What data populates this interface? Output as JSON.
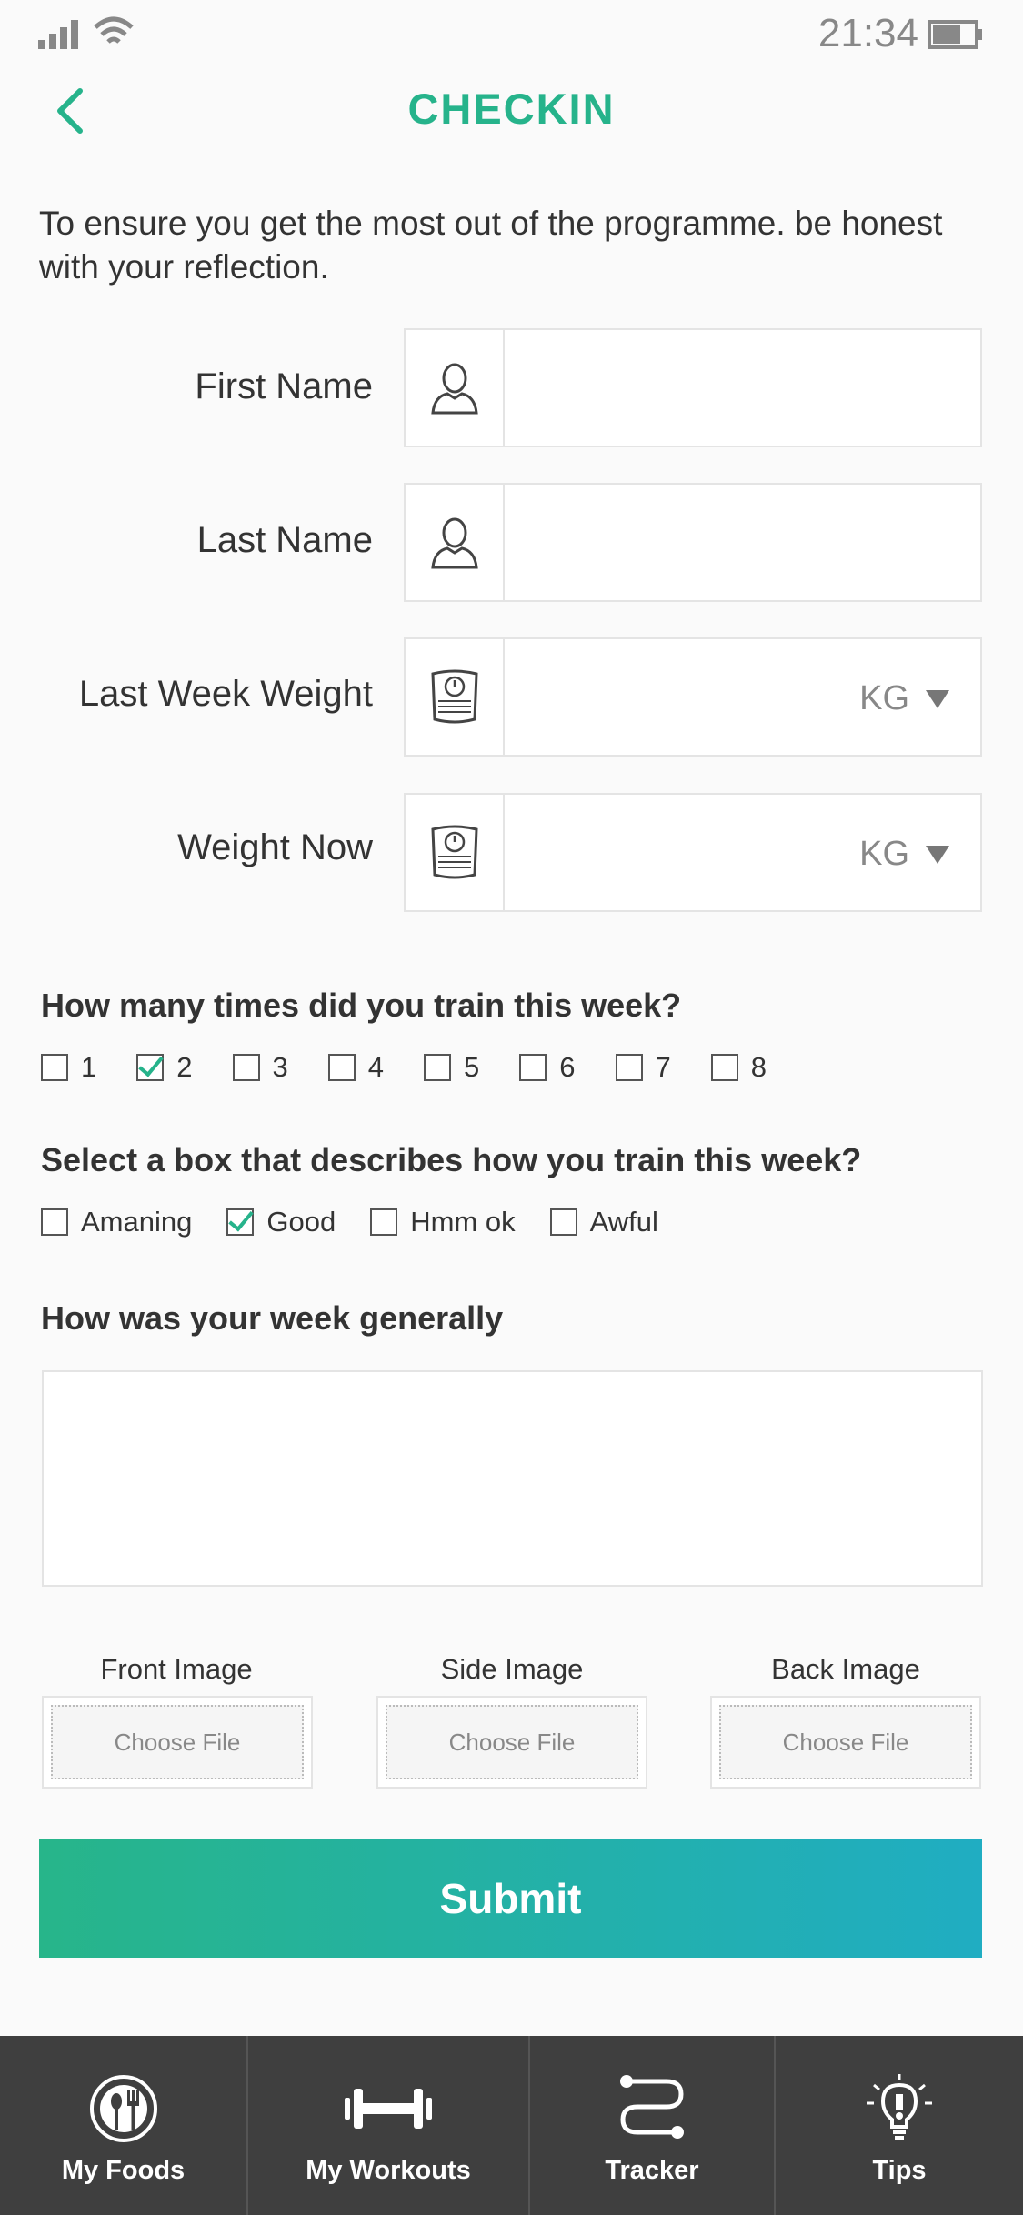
{
  "status": {
    "time": "21:34"
  },
  "header": {
    "title": "CHECKIN"
  },
  "intro": "To ensure you get the most out of the programme. be honest with your reflection.",
  "form": {
    "first_name": {
      "label": "First Name",
      "value": ""
    },
    "last_name": {
      "label": "Last Name",
      "value": ""
    },
    "last_week_weight": {
      "label": "Last Week Weight",
      "value": "",
      "unit": "KG"
    },
    "weight_now": {
      "label": "Weight Now",
      "value": "",
      "unit": "KG"
    }
  },
  "training": {
    "question": "How many times did you train this week?",
    "options": [
      {
        "label": "1",
        "checked": false
      },
      {
        "label": "2",
        "checked": true
      },
      {
        "label": "3",
        "checked": false
      },
      {
        "label": "4",
        "checked": false
      },
      {
        "label": "5",
        "checked": false
      },
      {
        "label": "6",
        "checked": false
      },
      {
        "label": "7",
        "checked": false
      },
      {
        "label": "8",
        "checked": false
      }
    ]
  },
  "quality": {
    "question": "Select a box that describes how you train this week?",
    "options": [
      {
        "label": "Amaning",
        "checked": false
      },
      {
        "label": "Good",
        "checked": true
      },
      {
        "label": "Hmm ok",
        "checked": false
      },
      {
        "label": "Awful",
        "checked": false
      }
    ]
  },
  "week": {
    "question": "How was your week generally",
    "value": ""
  },
  "images": [
    {
      "label": "Front Image",
      "button": "Choose File"
    },
    {
      "label": "Side Image",
      "button": "Choose File"
    },
    {
      "label": "Back Image",
      "button": "Choose File"
    }
  ],
  "submit_label": "Submit",
  "tabs": [
    {
      "label": "My Foods",
      "icon": "plate-cutlery-icon"
    },
    {
      "label": "My Workouts",
      "icon": "dumbbell-icon"
    },
    {
      "label": "Tracker",
      "icon": "route-tracker-icon"
    },
    {
      "label": "Tips",
      "icon": "lightbulb-icon"
    }
  ],
  "colors": {
    "accent": "#26b38b",
    "gradient_end": "#20adc2",
    "tabbar": "#3f3f3f"
  }
}
